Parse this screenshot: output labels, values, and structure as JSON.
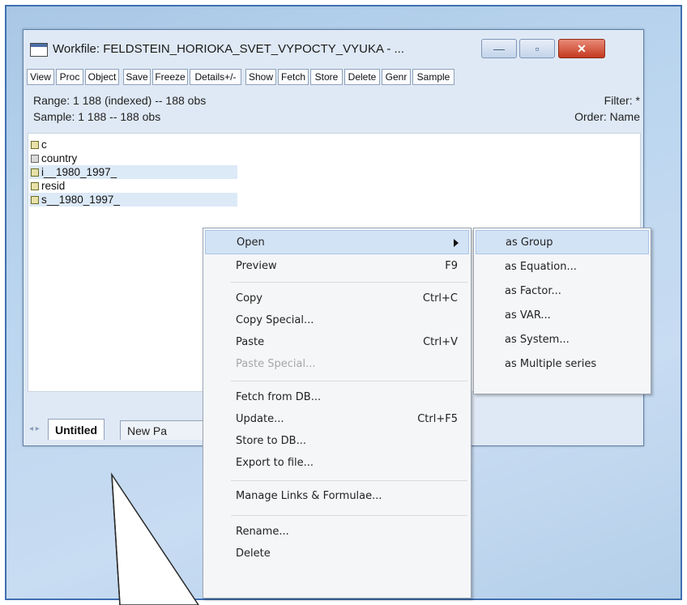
{
  "window": {
    "title": "Workfile: FELDSTEIN_HORIOKA_SVET_VYPOCTY_VYUKA - ...",
    "buttons": {
      "minimize": "—",
      "maximize": "▫",
      "close": "✕"
    }
  },
  "toolbar": [
    "View",
    "Proc",
    "Object",
    "Save",
    "Freeze",
    "Details+/-",
    "Show",
    "Fetch",
    "Store",
    "Delete",
    "Genr",
    "Sample"
  ],
  "info": {
    "range": "Range:  1 188 (indexed)  --  188 obs",
    "filter": "Filter: *",
    "sample": "Sample: 1 188  --  188 obs",
    "order": "Order: Name"
  },
  "objects": [
    {
      "name": "c",
      "icon": "coef-icon",
      "selected": false
    },
    {
      "name": "country",
      "icon": "alpha-series-icon",
      "selected": false
    },
    {
      "name": "i__1980_1997_",
      "icon": "series-icon",
      "selected": true
    },
    {
      "name": "resid",
      "icon": "series-icon",
      "selected": false
    },
    {
      "name": "s__1980_1997_",
      "icon": "series-icon",
      "selected": true
    }
  ],
  "tabs": {
    "active": "Untitled",
    "other": "New Pa"
  },
  "context_menu": {
    "items": [
      {
        "label": "Open",
        "shortcut": "",
        "submenu": true,
        "highlight": true
      },
      {
        "label": "Preview",
        "shortcut": "F9"
      },
      {
        "label": "Copy",
        "shortcut": "Ctrl+C"
      },
      {
        "label": "Copy Special...",
        "shortcut": ""
      },
      {
        "label": "Paste",
        "shortcut": "Ctrl+V"
      },
      {
        "label": "Paste Special...",
        "shortcut": "",
        "disabled": true
      },
      {
        "label": "Fetch from DB...",
        "shortcut": ""
      },
      {
        "label": "Update...",
        "shortcut": "Ctrl+F5"
      },
      {
        "label": "Store to DB...",
        "shortcut": ""
      },
      {
        "label": "Export to file...",
        "shortcut": ""
      },
      {
        "label": "Manage Links & Formulae...",
        "shortcut": ""
      },
      {
        "label": "Rename...",
        "shortcut": ""
      },
      {
        "label": "Delete",
        "shortcut": ""
      }
    ]
  },
  "submenu": {
    "items": [
      "as Group",
      "as Equation...",
      "as Factor...",
      "as VAR...",
      "as System...",
      "as Multiple series"
    ]
  }
}
